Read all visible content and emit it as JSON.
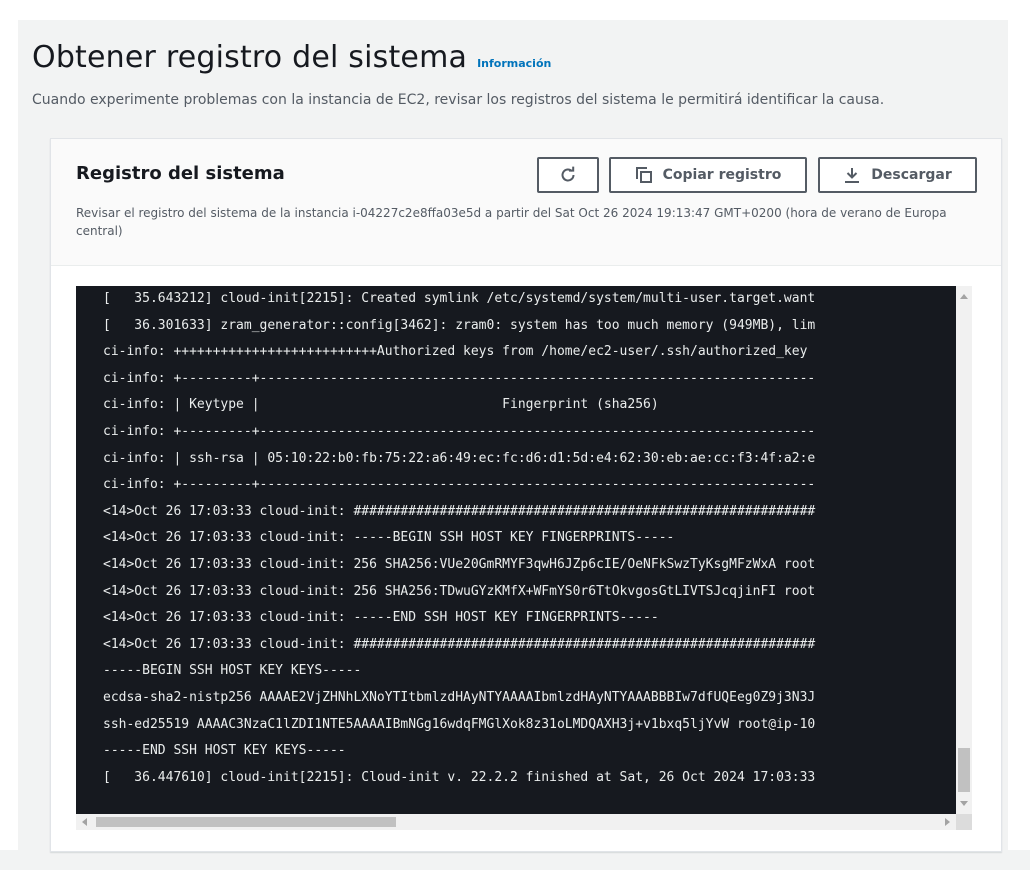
{
  "page": {
    "title": "Obtener registro del sistema",
    "info_link": "Información",
    "description": "Cuando experimente problemas con la instancia de EC2, revisar los registros del sistema le permitirá identificar la causa."
  },
  "panel": {
    "title": "Registro del sistema",
    "description": "Revisar el registro del sistema de la instancia i-04227c2e8ffa03e5d a partir del Sat Oct 26 2024 19:13:47 GMT+0200 (hora de verano de Europa central)",
    "buttons": {
      "refresh_icon": "refresh-icon",
      "copy_label": "Copiar registro",
      "copy_icon": "copy-icon",
      "download_label": "Descargar",
      "download_icon": "download-icon"
    }
  },
  "log": {
    "lines": [
      "[   35.643212] cloud-init[2215]: Created symlink /etc/systemd/system/multi-user.target.want",
      "[   36.301633] zram_generator::config[3462]: zram0: system has too much memory (949MB), lim",
      "ci-info: ++++++++++++++++++++++++++Authorized keys from /home/ec2-user/.ssh/authorized_key",
      "ci-info: +---------+-----------------------------------------------------------------------",
      "ci-info: | Keytype |                               Fingerprint (sha256)",
      "ci-info: +---------+-----------------------------------------------------------------------",
      "ci-info: | ssh-rsa | 05:10:22:b0:fb:75:22:a6:49:ec:fc:d6:d1:5d:e4:62:30:eb:ae:cc:f3:4f:a2:e",
      "ci-info: +---------+-----------------------------------------------------------------------",
      "<14>Oct 26 17:03:33 cloud-init: ###########################################################",
      "<14>Oct 26 17:03:33 cloud-init: -----BEGIN SSH HOST KEY FINGERPRINTS-----",
      "<14>Oct 26 17:03:33 cloud-init: 256 SHA256:VUe20GmRMYF3qwH6JZp6cIE/OeNFkSwzTyKsgMFzWxA root",
      "<14>Oct 26 17:03:33 cloud-init: 256 SHA256:TDwuGYzKMfX+WFmYS0r6TtOkvgosGtLIVTSJcqjinFI root",
      "<14>Oct 26 17:03:33 cloud-init: -----END SSH HOST KEY FINGERPRINTS-----",
      "<14>Oct 26 17:03:33 cloud-init: ###########################################################",
      "-----BEGIN SSH HOST KEY KEYS-----",
      "ecdsa-sha2-nistp256 AAAAE2VjZHNhLXNoYTItbmlzdHAyNTYAAAAIbmlzdHAyNTYAAABBBIw7dfUQEeg0Z9j3N3J",
      "ssh-ed25519 AAAAC3NzaC1lZDI1NTE5AAAAIBmNGg16wdqFMGlXok8z31oLMDQAXH3j+v1bxq5ljYvW root@ip-10",
      "-----END SSH HOST KEY KEYS-----",
      "[   36.447610] cloud-init[2215]: Cloud-init v. 22.2.2 finished at Sat, 26 Oct 2024 17:03:33"
    ]
  }
}
